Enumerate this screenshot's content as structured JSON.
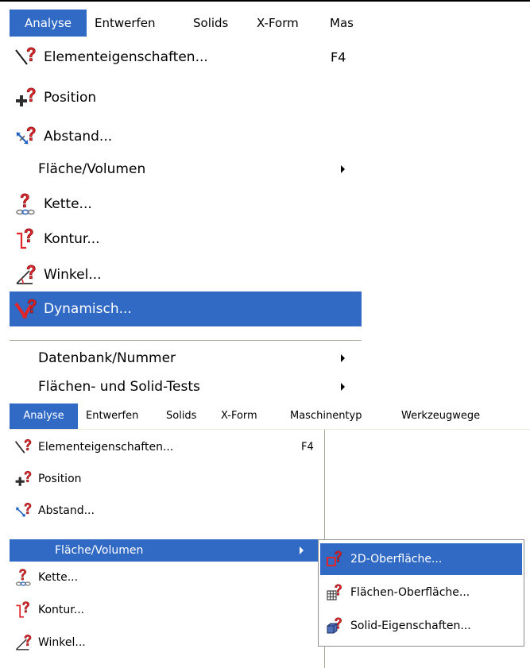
{
  "menubar": {
    "items": [
      "Analyse",
      "Entwerfen",
      "Solids",
      "X-Form",
      "Mas"
    ]
  },
  "menu": {
    "items": [
      {
        "label": "Elementeigenschaften...",
        "shortcut": "F4",
        "icon": "element-properties-icon"
      },
      {
        "label": "Position",
        "icon": "position-icon"
      },
      {
        "label": "Abstand...",
        "icon": "distance-icon"
      },
      {
        "label": "Fläche/Volumen",
        "submenu": true
      },
      {
        "label": "Kette...",
        "icon": "chain-icon"
      },
      {
        "label": "Kontur...",
        "icon": "contour-icon"
      },
      {
        "label": "Winkel...",
        "icon": "angle-icon"
      },
      {
        "label": "Dynamisch...",
        "icon": "dynamic-icon",
        "highlighted": true
      },
      {
        "label": "Datenbank/Nummer",
        "submenu": true
      },
      {
        "label": "Flächen- und Solid-Tests",
        "submenu": true
      }
    ]
  },
  "menubar2": {
    "items": [
      "Analyse",
      "Entwerfen",
      "Solids",
      "X-Form",
      "Maschinentyp",
      "Werkzeugwege"
    ]
  },
  "menu2": {
    "items": [
      {
        "label": "Elementeigenschaften...",
        "shortcut": "F4"
      },
      {
        "label": "Position"
      },
      {
        "label": "Abstand..."
      },
      {
        "label": "Fläche/Volumen",
        "highlighted": true,
        "submenu": true
      },
      {
        "label": "Kette..."
      },
      {
        "label": "Kontur..."
      },
      {
        "label": "Winkel..."
      }
    ]
  },
  "submenu": {
    "items": [
      {
        "label": "2D-Oberfläche...",
        "icon": "2d-area-icon",
        "highlighted": true
      },
      {
        "label": "Flächen-Oberfläche...",
        "icon": "surface-area-icon"
      },
      {
        "label": "Solid-Eigenschaften...",
        "icon": "solid-properties-icon"
      }
    ]
  },
  "colors": {
    "highlight": "#316ac5",
    "question_mark": "#e0262b",
    "icon_blue": "#1f5fbf",
    "separator": "#aca899"
  }
}
